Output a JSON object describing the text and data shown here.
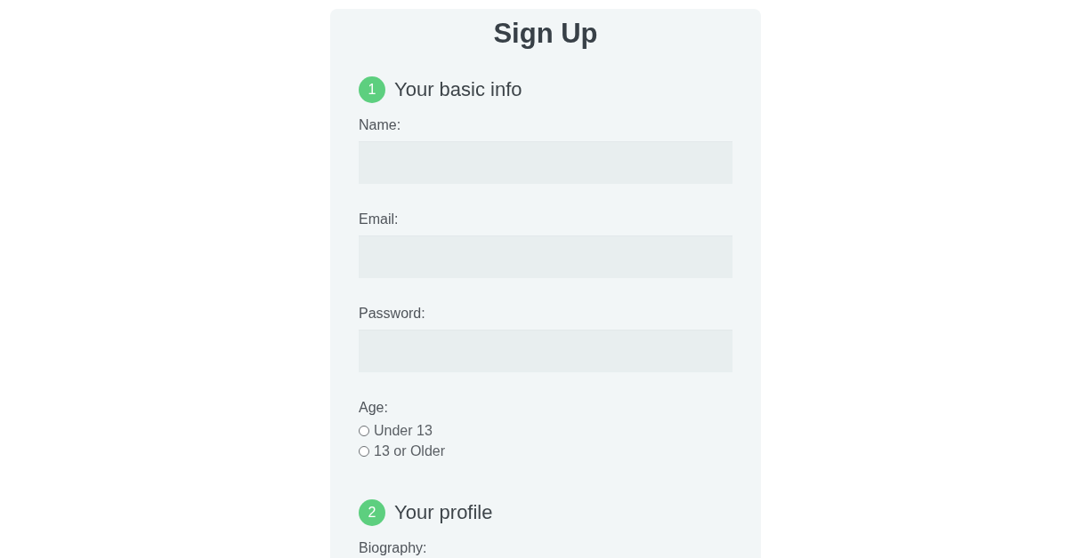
{
  "title": "Sign Up",
  "sections": [
    {
      "number": "1",
      "heading": "Your basic info",
      "fields": [
        {
          "kind": "text",
          "label": "Name:"
        },
        {
          "kind": "text",
          "label": "Email:"
        },
        {
          "kind": "text",
          "label": "Password:"
        },
        {
          "kind": "radio",
          "label": "Age:",
          "options": [
            {
              "label": "Under 13",
              "selected": false
            },
            {
              "label": "13 or Older",
              "selected": false
            }
          ]
        }
      ]
    },
    {
      "number": "2",
      "heading": "Your profile",
      "fields": [
        {
          "kind": "label",
          "label": "Biography:"
        }
      ]
    }
  ]
}
